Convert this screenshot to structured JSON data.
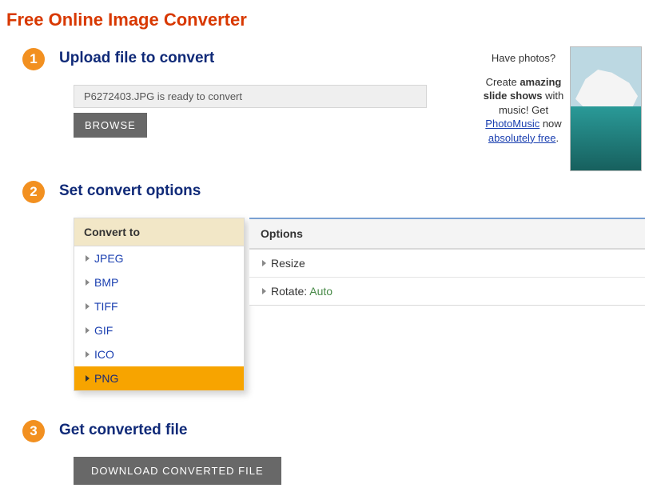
{
  "title": "Free Online Image Converter",
  "steps": {
    "s1": {
      "num": "1",
      "heading": "Upload file to convert"
    },
    "s2": {
      "num": "2",
      "heading": "Set convert options"
    },
    "s3": {
      "num": "3",
      "heading": "Get converted file"
    }
  },
  "upload": {
    "status": "P6272403.JPG is ready to convert",
    "browse_label": "BROWSE"
  },
  "convert": {
    "list_header": "Convert to",
    "formats": {
      "f0": "JPEG",
      "f1": "BMP",
      "f2": "TIFF",
      "f3": "GIF",
      "f4": "ICO",
      "f5": "PNG"
    },
    "options_header": "Options",
    "opt_resize": "Resize",
    "opt_rotate_label": "Rotate:",
    "opt_rotate_value": "Auto"
  },
  "download": {
    "button_label": "DOWNLOAD CONVERTED FILE"
  },
  "promo": {
    "line1": "Have photos?",
    "line2a": "Create ",
    "line2b": "amazing slide shows",
    "line2c": " with music! Get ",
    "link1": "PhotoMusic",
    "line3": " now ",
    "link2": "absolutely free",
    "dot": "."
  }
}
